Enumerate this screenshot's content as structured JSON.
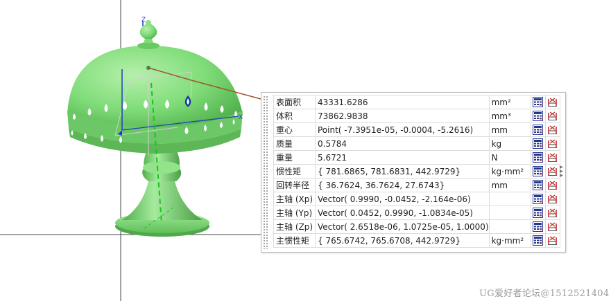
{
  "measurements": [
    {
      "name": "表面积",
      "value": "43331.6286",
      "unit": "mm²"
    },
    {
      "name": "体积",
      "value": "73862.9838",
      "unit": "mm³"
    },
    {
      "name": "重心",
      "value": "Point( -7.3951e-05, -0.0004, -5.2616)",
      "unit": "mm"
    },
    {
      "name": "质量",
      "value": "0.5784",
      "unit": "kg"
    },
    {
      "name": "重量",
      "value": "5.6721",
      "unit": "N"
    },
    {
      "name": "惯性矩",
      "value": "{ 781.6865, 781.6831, 442.9729}",
      "unit": "kg·mm²"
    },
    {
      "name": "回转半径",
      "value": "{ 36.7624, 36.7624, 27.6743}",
      "unit": "mm"
    },
    {
      "name": "主轴 (Xp)",
      "value": "Vector( 0.9990, -0.0452, -2.164e-06)",
      "unit": ""
    },
    {
      "name": "主轴 (Yp)",
      "value": "Vector( 0.0452, 0.9990, -1.0834e-05)",
      "unit": ""
    },
    {
      "name": "主轴 (Zp)",
      "value": "Vector( 2.6518e-06, 1.0725e-05, 1.0000)",
      "unit": ""
    },
    {
      "name": "主惯性矩",
      "value": "{ 765.6742, 765.6708, 442.9729}",
      "unit": "kg·mm²"
    }
  ],
  "row_icons": [
    "calculator-icon",
    "measure-icon"
  ],
  "axis_labels": {
    "z": "Z",
    "x": "X"
  },
  "watermark": "UG爱好者论坛@1512521404",
  "colors": {
    "model": "#7fdc78",
    "leader": "#a0522d",
    "axis_z": "#1f3fbf",
    "axis_x": "#1f3fbf",
    "highlight": "#1c3c9c",
    "accent_green": "#17c41e"
  }
}
